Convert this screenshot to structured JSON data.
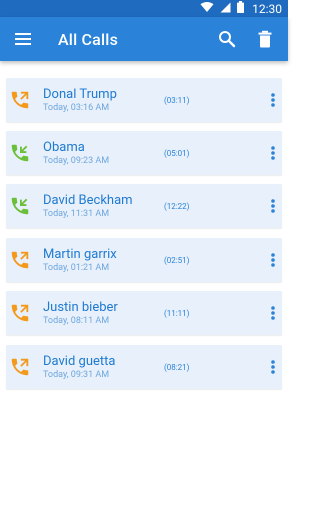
{
  "status_bar": {
    "time": "12:30",
    "icons": [
      "wifi-icon",
      "signal-icon",
      "battery-icon"
    ]
  },
  "app_bar": {
    "title": "All Calls",
    "icons": [
      "menu-icon",
      "search-icon",
      "delete-icon"
    ]
  },
  "colors": {
    "status_bar": "#1f6bbf",
    "app_bar": "#2b83d9",
    "card_bg": "#e8f1fb",
    "outgoing": "#f39a1e",
    "incoming": "#6bbf3a",
    "name": "#1f7ad1",
    "subtext": "#6fa6dd"
  },
  "calls": [
    {
      "name": "Donal Trump",
      "datetime": "Today, 03:16 AM",
      "duration": "(03:11)",
      "type": "outgoing",
      "icon": "outgoing-call-icon"
    },
    {
      "name": "Obama",
      "datetime": "Today, 09:23 AM",
      "duration": "(05:01)",
      "type": "incoming",
      "icon": "incoming-call-icon"
    },
    {
      "name": "David Beckham",
      "datetime": "Today, 11:31 AM",
      "duration": "(12:22)",
      "type": "incoming",
      "icon": "incoming-call-icon"
    },
    {
      "name": "Martin garrix",
      "datetime": "Today, 01:21 AM",
      "duration": "(02:51)",
      "type": "outgoing",
      "icon": "outgoing-call-icon"
    },
    {
      "name": "Justin bieber",
      "datetime": "Today, 08:11 AM",
      "duration": "(11:11)",
      "type": "outgoing",
      "icon": "outgoing-call-icon"
    },
    {
      "name": "David guetta",
      "datetime": "Today, 09:31 AM",
      "duration": "(08:21)",
      "type": "outgoing",
      "icon": "outgoing-call-icon"
    }
  ]
}
